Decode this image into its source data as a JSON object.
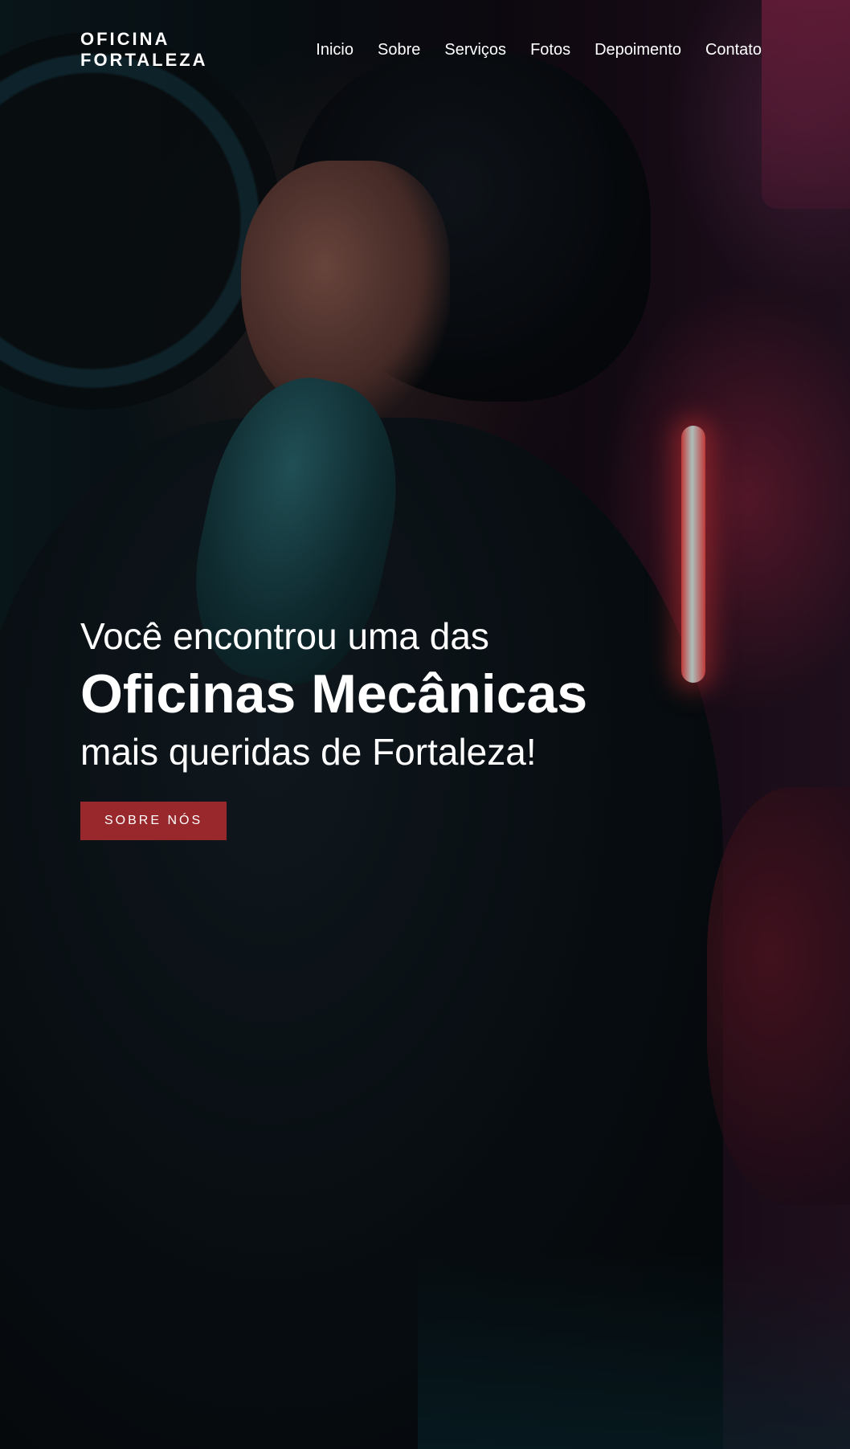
{
  "brand": {
    "line1": "OFICINA",
    "line2": "FORTALEZA"
  },
  "nav": {
    "items": [
      {
        "label": "Inicio"
      },
      {
        "label": "Sobre"
      },
      {
        "label": "Serviços"
      },
      {
        "label": "Fotos"
      },
      {
        "label": "Depoimento"
      },
      {
        "label": "Contato"
      }
    ]
  },
  "hero": {
    "line1": "Você encontrou uma das",
    "line2": "Oficinas Mecânicas",
    "line3": "mais queridas de Fortaleza!",
    "cta_label": "SOBRE NÓS",
    "background_image": "mechanic-under-car-with-work-lamp"
  },
  "colors": {
    "text": "#ffffff",
    "cta_background": "#98282b",
    "accent_neon": "#ff4d4d"
  }
}
